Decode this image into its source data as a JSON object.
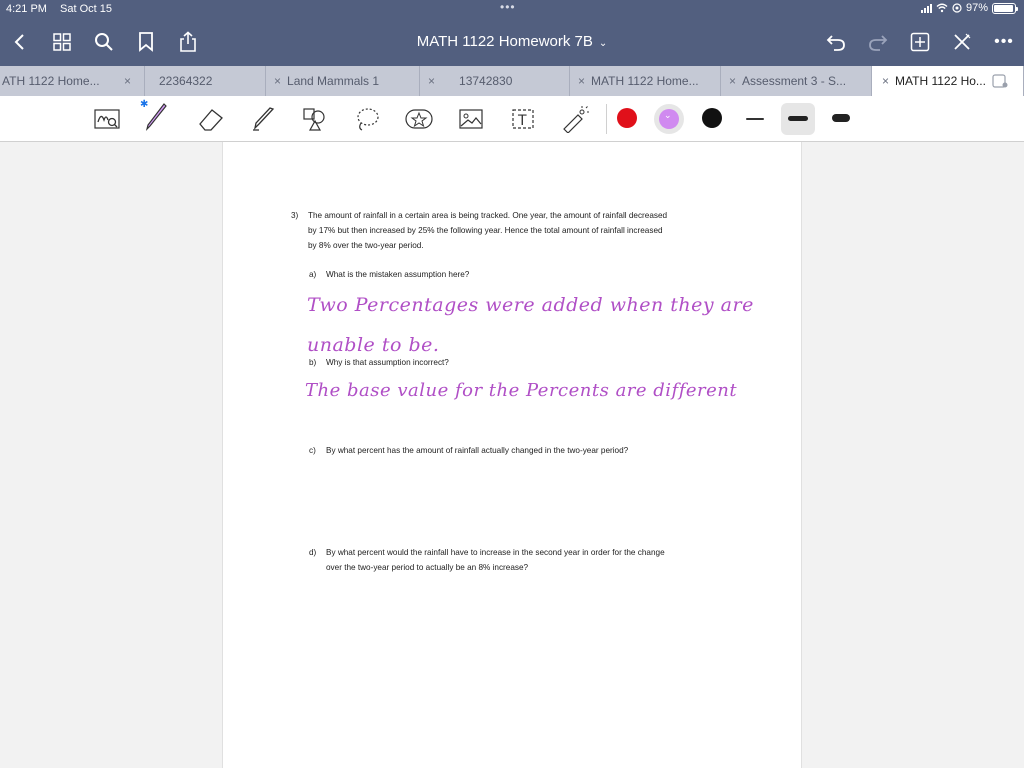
{
  "status": {
    "time": "4:21 PM",
    "date": "Sat Oct 15",
    "battery": "97%",
    "battery_level": 0.97
  },
  "header": {
    "title": "MATH 1122 Homework 7B"
  },
  "tabs": [
    {
      "label": "ATH 1122 Home...",
      "close": "×"
    },
    {
      "label": "22364322",
      "close": "×"
    },
    {
      "label": "Land Mammals 1",
      "close": "×"
    },
    {
      "label": "13742830",
      "close": "×"
    },
    {
      "label": "MATH 1122 Home...",
      "close": "×"
    },
    {
      "label": "Assessment 3 - S...",
      "close": "×"
    },
    {
      "label": "MATH 1122 Ho...",
      "close": "×"
    }
  ],
  "colors": {
    "accent": "#525f7f",
    "red": "#e0101a",
    "purple": "#d08af0",
    "black": "#111111",
    "ink": "#b04fc6"
  },
  "tools": [
    "lasso-note-icon",
    "pen-icon",
    "eraser-icon",
    "highlighter-icon",
    "shapes-icon",
    "lasso-icon",
    "sticker-icon",
    "image-icon",
    "text-icon",
    "laser-icon"
  ],
  "question": {
    "number": "3)",
    "line1": "The amount of rainfall in a certain area is being tracked.  One year, the amount of rainfall decreased",
    "line2": "by 17% but then increased by 25% the following year. Hence the total amount of rainfall increased",
    "line3": "by 8% over the two-year period.",
    "a_label": "a)",
    "a_text": "What is the mistaken assumption here?",
    "a_answer1": "Two Percentages were added when they are",
    "a_answer2": "unable to be.",
    "b_label": "b)",
    "b_text": "Why is that assumption incorrect?",
    "b_answer": "The base value for the Percents are different",
    "c_label": "c)",
    "c_text": "By what percent has the amount of rainfall actually changed in the two-year period?",
    "d_label": "d)",
    "d_text1": "By what percent would the rainfall have to increase in the second year in order for the change",
    "d_text2": "over the two-year period to actually be an 8% increase?"
  }
}
